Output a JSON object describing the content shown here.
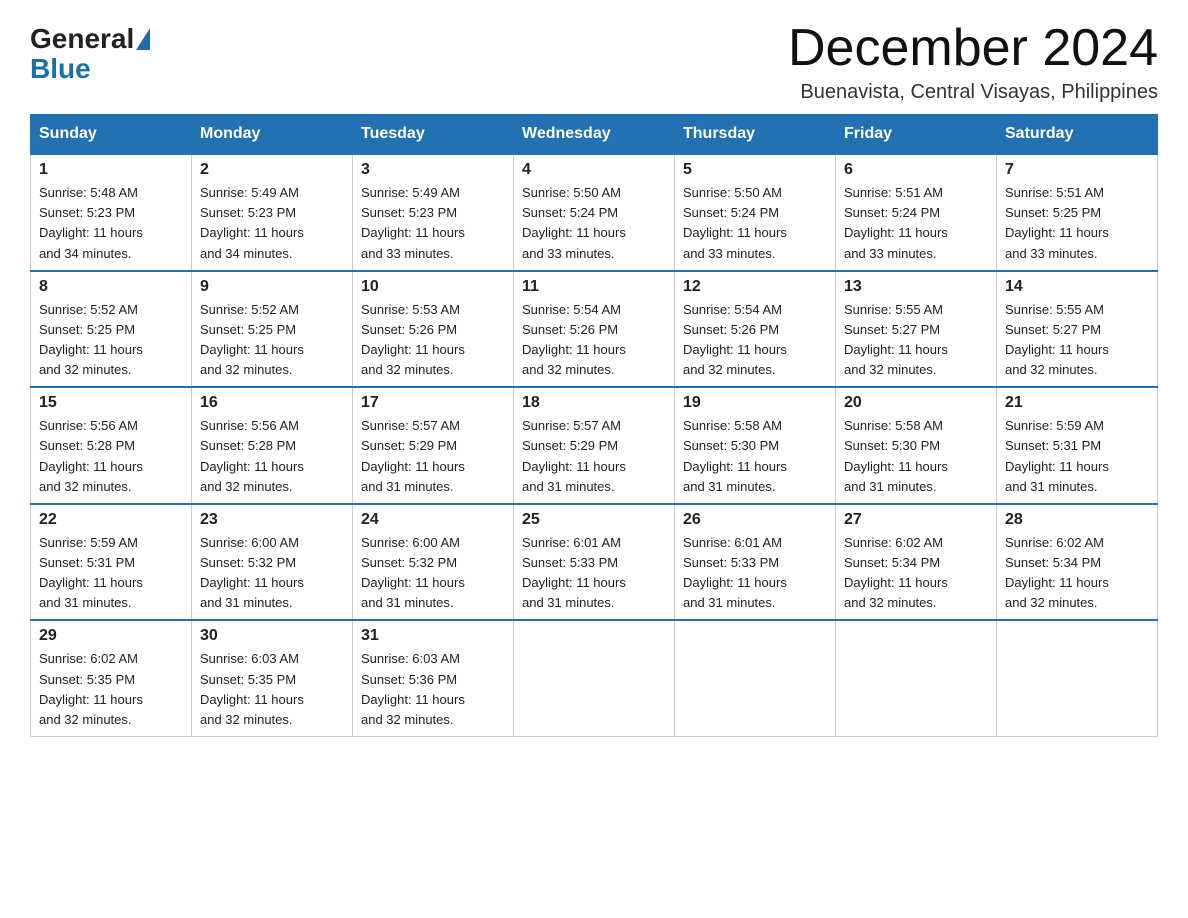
{
  "logo": {
    "general": "General",
    "blue": "Blue"
  },
  "title": {
    "month_year": "December 2024",
    "location": "Buenavista, Central Visayas, Philippines"
  },
  "weekdays": [
    "Sunday",
    "Monday",
    "Tuesday",
    "Wednesday",
    "Thursday",
    "Friday",
    "Saturday"
  ],
  "weeks": [
    [
      {
        "day": "1",
        "sunrise": "5:48 AM",
        "sunset": "5:23 PM",
        "daylight": "11 hours and 34 minutes."
      },
      {
        "day": "2",
        "sunrise": "5:49 AM",
        "sunset": "5:23 PM",
        "daylight": "11 hours and 34 minutes."
      },
      {
        "day": "3",
        "sunrise": "5:49 AM",
        "sunset": "5:23 PM",
        "daylight": "11 hours and 33 minutes."
      },
      {
        "day": "4",
        "sunrise": "5:50 AM",
        "sunset": "5:24 PM",
        "daylight": "11 hours and 33 minutes."
      },
      {
        "day": "5",
        "sunrise": "5:50 AM",
        "sunset": "5:24 PM",
        "daylight": "11 hours and 33 minutes."
      },
      {
        "day": "6",
        "sunrise": "5:51 AM",
        "sunset": "5:24 PM",
        "daylight": "11 hours and 33 minutes."
      },
      {
        "day": "7",
        "sunrise": "5:51 AM",
        "sunset": "5:25 PM",
        "daylight": "11 hours and 33 minutes."
      }
    ],
    [
      {
        "day": "8",
        "sunrise": "5:52 AM",
        "sunset": "5:25 PM",
        "daylight": "11 hours and 32 minutes."
      },
      {
        "day": "9",
        "sunrise": "5:52 AM",
        "sunset": "5:25 PM",
        "daylight": "11 hours and 32 minutes."
      },
      {
        "day": "10",
        "sunrise": "5:53 AM",
        "sunset": "5:26 PM",
        "daylight": "11 hours and 32 minutes."
      },
      {
        "day": "11",
        "sunrise": "5:54 AM",
        "sunset": "5:26 PM",
        "daylight": "11 hours and 32 minutes."
      },
      {
        "day": "12",
        "sunrise": "5:54 AM",
        "sunset": "5:26 PM",
        "daylight": "11 hours and 32 minutes."
      },
      {
        "day": "13",
        "sunrise": "5:55 AM",
        "sunset": "5:27 PM",
        "daylight": "11 hours and 32 minutes."
      },
      {
        "day": "14",
        "sunrise": "5:55 AM",
        "sunset": "5:27 PM",
        "daylight": "11 hours and 32 minutes."
      }
    ],
    [
      {
        "day": "15",
        "sunrise": "5:56 AM",
        "sunset": "5:28 PM",
        "daylight": "11 hours and 32 minutes."
      },
      {
        "day": "16",
        "sunrise": "5:56 AM",
        "sunset": "5:28 PM",
        "daylight": "11 hours and 32 minutes."
      },
      {
        "day": "17",
        "sunrise": "5:57 AM",
        "sunset": "5:29 PM",
        "daylight": "11 hours and 31 minutes."
      },
      {
        "day": "18",
        "sunrise": "5:57 AM",
        "sunset": "5:29 PM",
        "daylight": "11 hours and 31 minutes."
      },
      {
        "day": "19",
        "sunrise": "5:58 AM",
        "sunset": "5:30 PM",
        "daylight": "11 hours and 31 minutes."
      },
      {
        "day": "20",
        "sunrise": "5:58 AM",
        "sunset": "5:30 PM",
        "daylight": "11 hours and 31 minutes."
      },
      {
        "day": "21",
        "sunrise": "5:59 AM",
        "sunset": "5:31 PM",
        "daylight": "11 hours and 31 minutes."
      }
    ],
    [
      {
        "day": "22",
        "sunrise": "5:59 AM",
        "sunset": "5:31 PM",
        "daylight": "11 hours and 31 minutes."
      },
      {
        "day": "23",
        "sunrise": "6:00 AM",
        "sunset": "5:32 PM",
        "daylight": "11 hours and 31 minutes."
      },
      {
        "day": "24",
        "sunrise": "6:00 AM",
        "sunset": "5:32 PM",
        "daylight": "11 hours and 31 minutes."
      },
      {
        "day": "25",
        "sunrise": "6:01 AM",
        "sunset": "5:33 PM",
        "daylight": "11 hours and 31 minutes."
      },
      {
        "day": "26",
        "sunrise": "6:01 AM",
        "sunset": "5:33 PM",
        "daylight": "11 hours and 31 minutes."
      },
      {
        "day": "27",
        "sunrise": "6:02 AM",
        "sunset": "5:34 PM",
        "daylight": "11 hours and 32 minutes."
      },
      {
        "day": "28",
        "sunrise": "6:02 AM",
        "sunset": "5:34 PM",
        "daylight": "11 hours and 32 minutes."
      }
    ],
    [
      {
        "day": "29",
        "sunrise": "6:02 AM",
        "sunset": "5:35 PM",
        "daylight": "11 hours and 32 minutes."
      },
      {
        "day": "30",
        "sunrise": "6:03 AM",
        "sunset": "5:35 PM",
        "daylight": "11 hours and 32 minutes."
      },
      {
        "day": "31",
        "sunrise": "6:03 AM",
        "sunset": "5:36 PM",
        "daylight": "11 hours and 32 minutes."
      },
      null,
      null,
      null,
      null
    ]
  ],
  "labels": {
    "sunrise": "Sunrise:",
    "sunset": "Sunset:",
    "daylight": "Daylight:"
  }
}
